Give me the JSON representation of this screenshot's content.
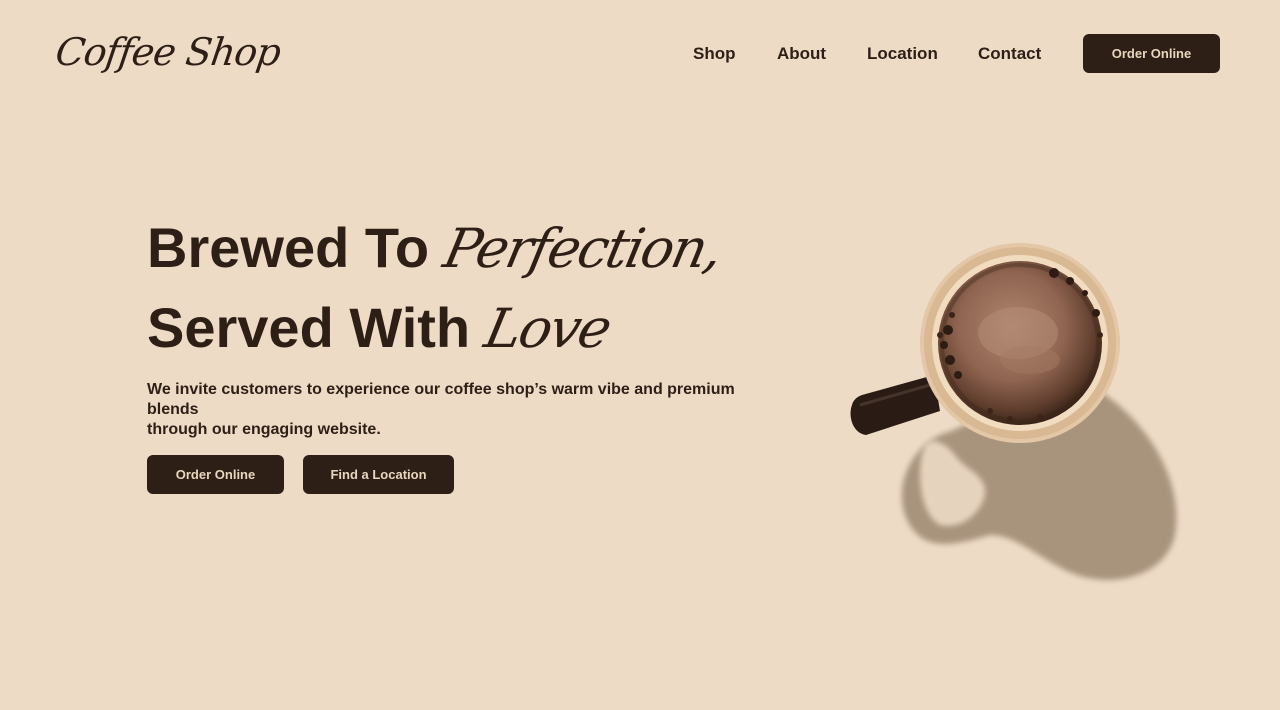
{
  "header": {
    "logo": "Coffee Shop",
    "nav": [
      "Shop",
      "About",
      "Location",
      "Contact"
    ],
    "cta_label": "Order Online"
  },
  "hero": {
    "line1_plain": "Brewed To ",
    "line1_script": "Perfection,",
    "line2_plain": "Served With ",
    "line2_script": "Love",
    "subtext_line1": "We invite customers to experience our coffee shop’s warm vibe and premium blends",
    "subtext_line2": "through our engaging website.",
    "primary_button": "Order Online",
    "secondary_button": "Find a Location"
  },
  "colors": {
    "background": "#eddbc6",
    "primary": "#2e1f16",
    "button_text": "#e9d6bf"
  },
  "icons": {
    "hero_image": "coffee-cup-illustration"
  }
}
